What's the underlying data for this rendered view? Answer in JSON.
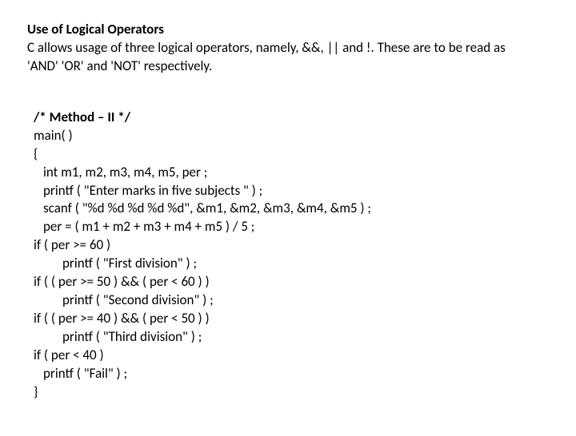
{
  "heading": "Use of Logical Operators",
  "intro_line1": "C allows usage of three logical operators, namely, &&, || and !. These are to be read as",
  "intro_line2": "'AND' 'OR' and 'NOT' respectively.",
  "code": {
    "l01": "/* Method – II */",
    "l02": "main( )",
    "l03": "{",
    "l04": "int m1, m2, m3, m4, m5, per ;",
    "l05": "printf ( \"Enter marks in five subjects \" ) ;",
    "l06": "scanf ( \"%d %d %d %d %d\", &m1, &m2, &m3, &m4, &m5 ) ;",
    "l07": "per = ( m1 + m2 + m3 + m4 + m5 ) / 5 ;",
    "l08": "if ( per >= 60 )",
    "l09": "printf ( \"First division\" ) ;",
    "l10": "if ( ( per >= 50 ) && ( per < 60 ) )",
    "l11": "printf ( \"Second division\" ) ;",
    "l12": "if ( ( per >= 40 ) && ( per < 50 ) )",
    "l13": "printf ( \"Third division\" ) ;",
    "l14": "if ( per < 40 )",
    "l15": "printf ( \"Fail\" ) ;",
    "l16": "}"
  }
}
